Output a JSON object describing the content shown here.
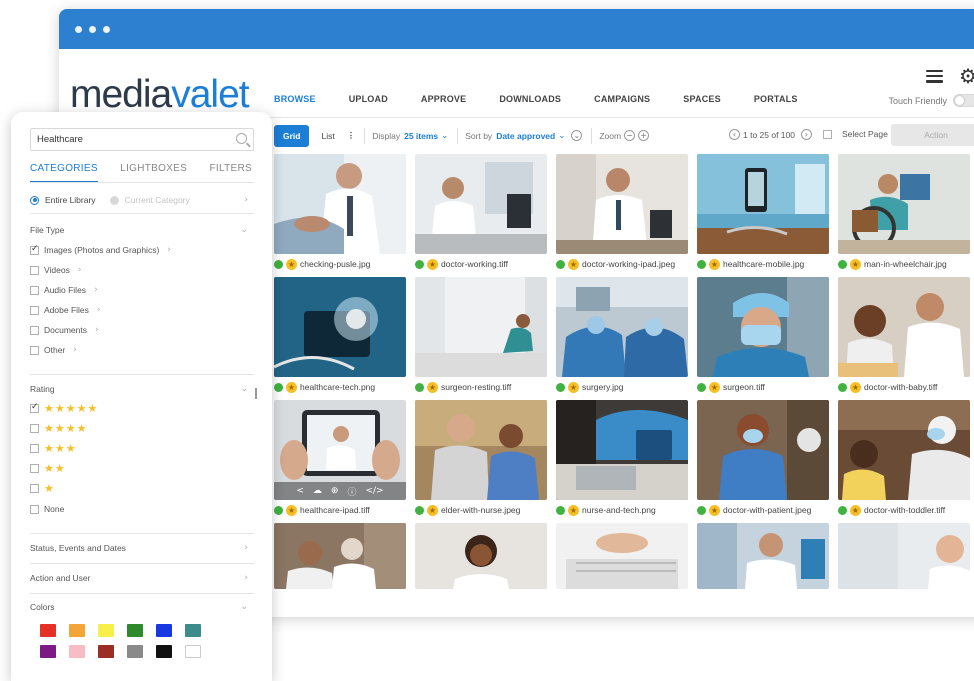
{
  "app": {
    "logo_part1": "media",
    "logo_part2": "valet"
  },
  "nav": {
    "items": [
      "BROWSE",
      "UPLOAD",
      "APPROVE",
      "DOWNLOADS",
      "CAMPAIGNS",
      "SPACES",
      "PORTALS"
    ],
    "touch_friendly": "Touch Friendly"
  },
  "toolbar": {
    "grid": "Grid",
    "list": "List",
    "display_label": "Display",
    "display_value": "25 items",
    "sort_label": "Sort by",
    "sort_value": "Date approved",
    "zoom_label": "Zoom",
    "pager": "1 to 25 of 100",
    "select_page": "Select Page",
    "action": "Action"
  },
  "assets": [
    "checking-pusle.jpg",
    "doctor-working.tiff",
    "doctor-working-ipad.jpeg",
    "healthcare-mobile.jpg",
    "man-in-wheelchair.jpg",
    "healthcare-tech.png",
    "surgeon-resting.tiff",
    "surgery.jpg",
    "surgeon.tiff",
    "doctor-with-baby.tiff",
    "healthcare-ipad.tiff",
    "elder-with-nurse.jpeg",
    "nurse-and-tech.png",
    "doctor-with-patient.jpeg",
    "doctor-with-toddler.tiff"
  ],
  "sidebar": {
    "search_value": "Healthcare",
    "tabs": [
      "CATEGORIES",
      "LIGHTBOXES",
      "FILTERS"
    ],
    "scope": {
      "entire": "Entire Library",
      "current": "Current Category"
    },
    "file_type_title": "File Type",
    "file_types": [
      "Images (Photos and Graphics)",
      "Videos",
      "Audio Files",
      "Adobe Files",
      "Documents",
      "Other"
    ],
    "rating_title": "Rating",
    "rating_stars": [
      5,
      4,
      3,
      2,
      1
    ],
    "rating_none": "None",
    "status_title": "Status, Events and Dates",
    "action_title": "Action and User",
    "colors_title": "Colors",
    "colors": [
      "#e53027",
      "#f4a53a",
      "#f8f04a",
      "#2c8a2c",
      "#1838e3",
      "#3d8b8a",
      "#7b1a82",
      "#f6bdc6",
      "#9a2e25",
      "#8a8a8a",
      "#111111",
      "#ffffff"
    ]
  }
}
